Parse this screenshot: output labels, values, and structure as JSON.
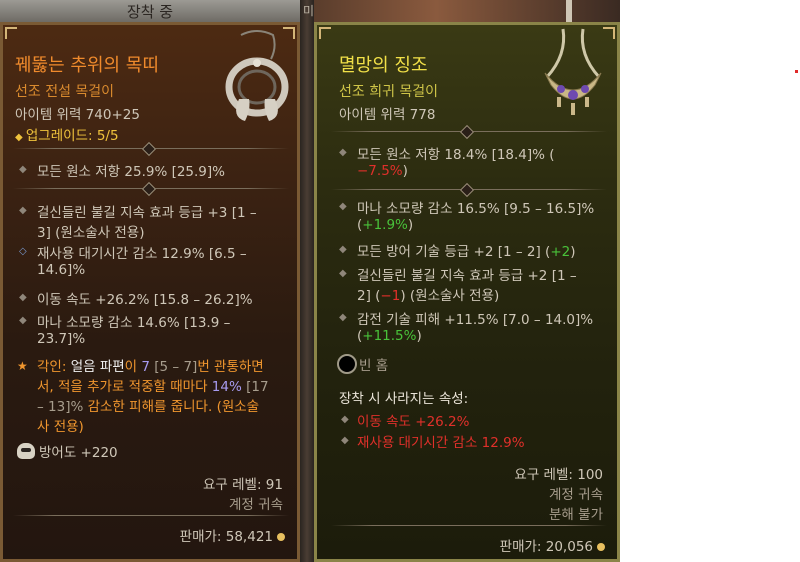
{
  "header": {
    "equipped_tab": "장착 중",
    "right_tab_fragment": "미"
  },
  "left_item": {
    "name": "꿰뚫는 추위의 목띠",
    "type": "선조 전설 목걸이",
    "power": "아이템 위력 740+25",
    "upgrade": "업그레이드: 5/5",
    "implicit": "모든 원소 저항 25.9% [25.9]%",
    "affixes": [
      {
        "line1": "걸신들린 불길 지속 효과 등급 +3 [1 –",
        "line2": "3] (원소술사 전용)",
        "icon": "diamond-bullet-icon"
      },
      {
        "line1": "재사용 대기시간 감소 12.9% [6.5 –",
        "line2": "14.6]%",
        "icon": "greater-affix-icon"
      },
      {
        "line1": "이동 속도 +26.2% [15.8 – 26.2]%",
        "line2": "",
        "icon": "diamond-bullet-icon"
      },
      {
        "line1": "마나 소모량 감소 14.6% [13.9 –",
        "line2": "23.7]%",
        "icon": "diamond-bullet-icon"
      }
    ],
    "aspect": {
      "p1": "각인: ",
      "p2": "얼음 파편",
      "p3": "이 ",
      "p4": "7",
      "p5": " [5 – 7]",
      "p6": "번 관통하면",
      "l2": "서, 적을 추가로 적중할 때마다 ",
      "l2b": "14%",
      "l2c": " [17",
      "l3": "– 13]%",
      "l3b": " 감소한 피해를 줍니다. (원소술",
      "l4": "사 전용)"
    },
    "armor": "방어도 +220",
    "req_level": "요구 레벨: 91",
    "account_bound": "계정 귀속",
    "sell_price": "판매가: 58,421"
  },
  "right_item": {
    "name": "멸망의 징조",
    "type": "선조 희귀 목걸이",
    "power": "아이템 위력 778",
    "implicit_l1": "모든 원소 저항 18.4% [18.4]% (",
    "implicit_l2": "−7.5%",
    "implicit_l2b": ")",
    "affixes": [
      {
        "line1": "마나 소모량 감소 16.5% [9.5 – 16.5]%",
        "line2a": "(",
        "diff": "+1.9%",
        "line2b": ")"
      },
      {
        "line1": "모든 방어 기술 등급 +2 [1 – 2] (",
        "diff_inline": "+2",
        "line1b": ")"
      },
      {
        "line1": "걸신들린 불길 지속 효과 등급 +2 [1 –",
        "line2a": "2] (",
        "diff": "−1",
        "line2b": ") (원소술사 전용)"
      },
      {
        "line1": "감전 기술 피해 +11.5% [7.0 – 14.0]%",
        "line2a": "(",
        "diff": "+11.5%",
        "line2b": ")"
      }
    ],
    "empty_socket": "빈 홈",
    "lost_header": "장착 시 사라지는 속성:",
    "lost": [
      "이동 속도 +26.2%",
      "재사용 대기시간 감소 12.9%"
    ],
    "req_level": "요구 레벨: 100",
    "account_bound": "계정 귀속",
    "no_salvage": "분해 불가",
    "sell_price": "판매가: 20,056"
  }
}
